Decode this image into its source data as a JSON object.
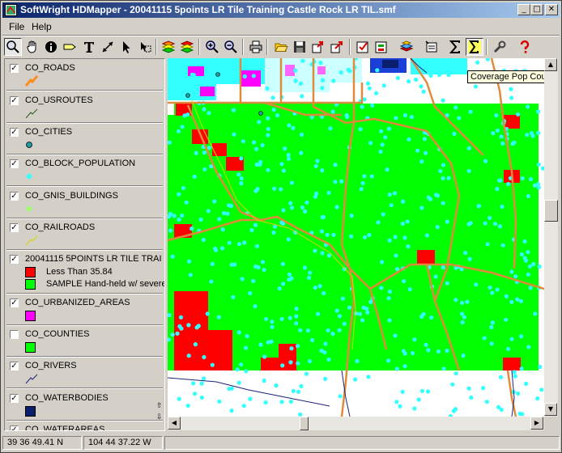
{
  "window": {
    "title": "SoftWright HDMapper - 20041115  5points LR Tile Training Castle Rock LR TIL.smf",
    "controls": {
      "minimize": "_",
      "maximize": "□",
      "close": "✕"
    }
  },
  "menu": [
    {
      "label": "File"
    },
    {
      "label": "Help"
    }
  ],
  "toolbar": {
    "tools": [
      "zoom-tool",
      "pan-tool",
      "info-tool",
      "label-tool",
      "text-tool",
      "measure-tool",
      "select-tool",
      "select-region-tool",
      "layers-tool",
      "layers-2-tool",
      "zoom-in-tool",
      "zoom-out-tool",
      "print-tool",
      "open-tool",
      "save-tool",
      "export-tool",
      "export-2-tool",
      "check-tool",
      "edit-tool",
      "stack-tool",
      "properties-tool",
      "sum-tool",
      "sum-coverage-tool",
      "settings-tool",
      "help-tool"
    ]
  },
  "tooltip": "Coverage Pop Count",
  "legend": {
    "layers": [
      {
        "name": "CO_ROADS",
        "checked": true,
        "symbol": "road-line-icon",
        "color": "#ff8c1a"
      },
      {
        "name": "CO_USROUTES",
        "checked": true,
        "symbol": "route-line-icon",
        "color": "#2a5a1a"
      },
      {
        "name": "CO_CITIES",
        "checked": true,
        "symbol": "city-dot-icon",
        "color": "#1f9aa0"
      },
      {
        "name": "CO_BLOCK_POPULATION",
        "checked": true,
        "symbol": "population-diamond-icon",
        "color": "#33ffff"
      },
      {
        "name": "CO_GNIS_BUILDINGS",
        "checked": true,
        "symbol": "building-diamond-icon",
        "color": "#99ff66"
      },
      {
        "name": "CO_RAILROADS",
        "checked": true,
        "symbol": "railroad-line-icon",
        "color": "#d4d400"
      },
      {
        "name": "20041115  5POINTS LR TILE TRAI",
        "checked": true,
        "items": [
          {
            "label": "Less Than 35.84",
            "color": "#ff0000"
          },
          {
            "label": "SAMPLE Hand-held w/ severe",
            "color": "#00ff00"
          }
        ]
      },
      {
        "name": "CO_URBANIZED_AREAS",
        "checked": true,
        "symbol": "urban-area-swatch",
        "color": "#ff00ff"
      },
      {
        "name": "CO_COUNTIES",
        "checked": false,
        "symbol": "county-swatch",
        "color": "#00ff00"
      },
      {
        "name": "CO_RIVERS",
        "checked": true,
        "symbol": "river-line-icon",
        "color": "#1a237e"
      },
      {
        "name": "CO_WATERBODIES",
        "checked": true,
        "symbol": "waterbody-swatch",
        "color": "#0a1f6b"
      },
      {
        "name": "CO_WATERAREAS",
        "checked": true
      }
    ]
  },
  "status": {
    "latitude": "39 36 49.41 N",
    "longitude": "104 44 37.22 W"
  },
  "colors": {
    "coverage_green": "#00ff00",
    "coverage_red": "#ff0000",
    "road_orange": "#e08a3c",
    "population_cyan": "#33ffff",
    "urban_magenta": "#ff00ff"
  }
}
